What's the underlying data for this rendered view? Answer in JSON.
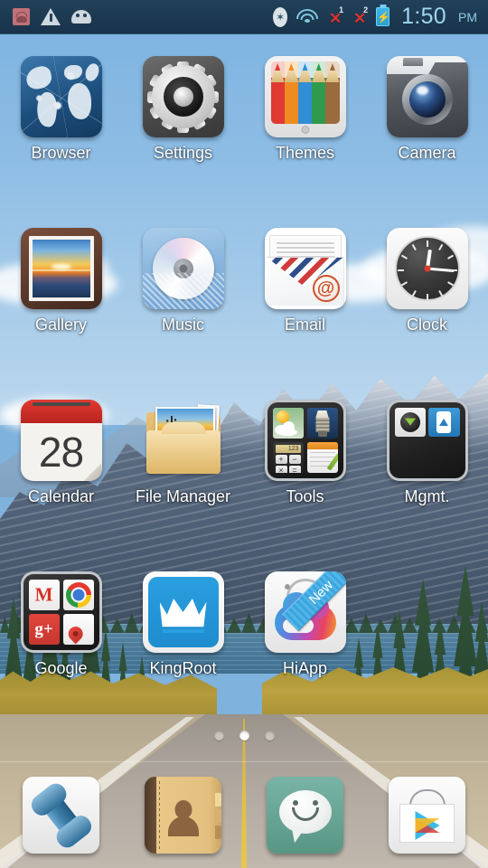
{
  "status_bar": {
    "left_icons": [
      {
        "name": "apk-installer-icon",
        "label": "APK"
      },
      {
        "name": "warning-icon",
        "label": "Warning"
      },
      {
        "name": "android-system-icon",
        "label": "Android"
      }
    ],
    "bluetooth_label": "Bluetooth",
    "wifi_label": "Wi-Fi",
    "sim1_badge": "1",
    "sim2_badge": "2",
    "sim_no_service_mark": "✕",
    "battery_label": "Charging",
    "time": "1:50",
    "ampm": "PM",
    "colors": {
      "bar_background": "#1c3950",
      "time_text": "#9fd8ee",
      "battery": "#2a9ed1",
      "error_x": "#d7342e"
    }
  },
  "home_screen": {
    "rows": [
      [
        {
          "label": "Browser",
          "icon": "browser-globe-icon"
        },
        {
          "label": "Settings",
          "icon": "settings-gear-icon"
        },
        {
          "label": "Themes",
          "icon": "themes-pencils-icon"
        },
        {
          "label": "Camera",
          "icon": "camera-icon"
        }
      ],
      [
        {
          "label": "Gallery",
          "icon": "gallery-photo-frame-icon"
        },
        {
          "label": "Music",
          "icon": "music-cd-icon"
        },
        {
          "label": "Email",
          "icon": "email-envelope-icon"
        },
        {
          "label": "Clock",
          "icon": "clock-analog-icon"
        }
      ],
      [
        {
          "label": "Calendar",
          "icon": "calendar-icon",
          "day": "28"
        },
        {
          "label": "File Manager",
          "icon": "file-manager-folder-icon"
        },
        {
          "label": "Tools",
          "icon": "tools-folder-icon"
        },
        {
          "label": "Mgmt.",
          "icon": "management-folder-icon"
        }
      ],
      [
        {
          "label": "Google",
          "icon": "google-folder-icon"
        },
        {
          "label": "KingRoot",
          "icon": "kingroot-crown-icon"
        },
        {
          "label": "HiApp",
          "icon": "hiapp-store-icon",
          "badge": "New"
        }
      ]
    ],
    "tools_folder_items": [
      "weather-icon",
      "flashlight-icon",
      "calculator-icon",
      "notes-icon"
    ],
    "calculator_display": "123",
    "mgmt_folder_items": [
      "downloads-icon",
      "phone-update-icon"
    ],
    "google_folder_items": [
      "gmail-icon",
      "chrome-icon",
      "google-plus-icon",
      "maps-icon"
    ],
    "gmail_glyph": "M",
    "google_plus_glyph": "g+",
    "page_dots": {
      "count": 3,
      "active_index": 1
    }
  },
  "dock": [
    {
      "label": "Phone",
      "icon": "phone-handset-icon"
    },
    {
      "label": "Contacts",
      "icon": "contacts-book-icon"
    },
    {
      "label": "Messaging",
      "icon": "messaging-smiley-bubble-icon"
    },
    {
      "label": "Play Store",
      "icon": "play-store-icon"
    }
  ],
  "theme": {
    "label_text": "#ffffff",
    "wallpaper": "mountain-road-landscape",
    "accent_blue": "#2a9fe0"
  }
}
